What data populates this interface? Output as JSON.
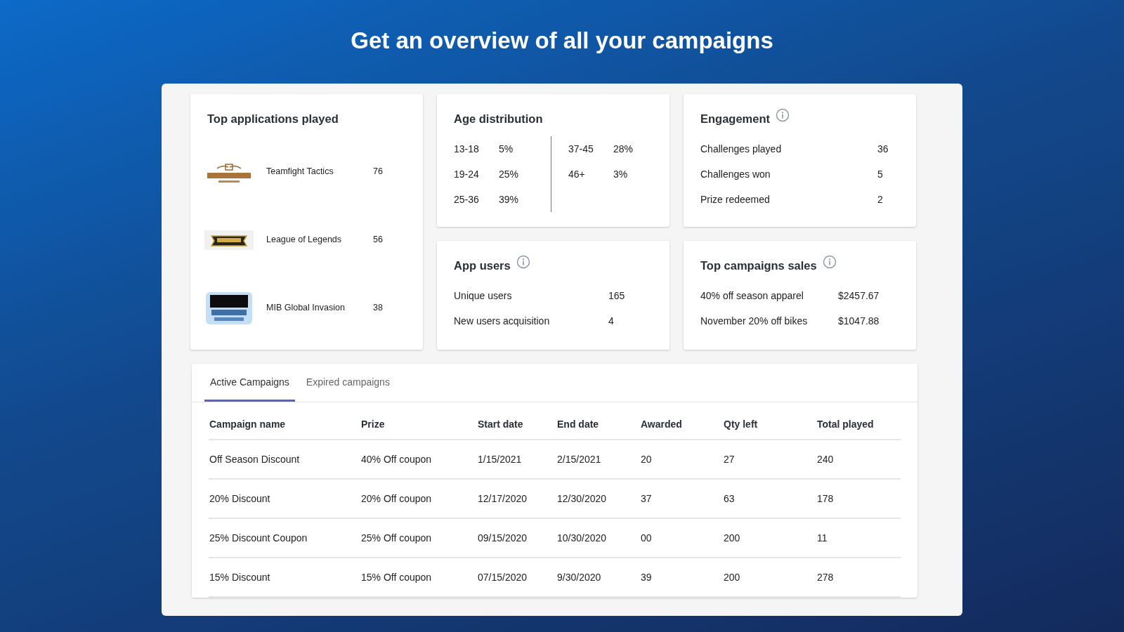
{
  "headline": "Get an overview of all your campaigns",
  "top_applications": {
    "title": "Top applications played",
    "items": [
      {
        "kind": "crest",
        "name": "Teamfight Tactics",
        "count": "76"
      },
      {
        "kind": "banner",
        "name": "League of Legends",
        "count": "56"
      },
      {
        "kind": "block",
        "name": "MIB Global Invasion",
        "count": "38"
      }
    ]
  },
  "age_distribution": {
    "title": "Age distribution",
    "groups": [
      [
        {
          "range": "13-18",
          "share": "5%"
        },
        {
          "range": "19-24",
          "share": "25%"
        },
        {
          "range": "25-36",
          "share": "39%"
        }
      ],
      [
        {
          "range": "37-45",
          "share": "28%"
        },
        {
          "range": "46+",
          "share": "3%"
        }
      ]
    ]
  },
  "engagement": {
    "title": "Engagement",
    "info": true,
    "rows": [
      {
        "label": "Challenges played",
        "value": "36"
      },
      {
        "label": "Challenges won",
        "value": "5"
      },
      {
        "label": "Prize redeemed",
        "value": "2"
      }
    ]
  },
  "app_users": {
    "title": "App users",
    "info": true,
    "rows": [
      {
        "label": "Unique users",
        "value": "165"
      },
      {
        "label": "New users acquisition",
        "value": "4"
      }
    ]
  },
  "top_campaign_sales": {
    "title": "Top campaigns sales",
    "info": true,
    "rows": [
      {
        "label": "40% off season apparel",
        "value": "$2457.67"
      },
      {
        "label": "November 20% off bikes",
        "value": "$1047.88"
      }
    ]
  },
  "tabs": [
    {
      "label": "Active Campaigns",
      "selected": true
    },
    {
      "label": "Expired campaigns",
      "selected": false
    }
  ],
  "table": {
    "columns": [
      "Campaign name",
      "Prize",
      "Start date",
      "End date",
      "Awarded",
      "Qty left",
      "Total played"
    ],
    "rows": [
      [
        "Off Season Discount",
        "40% Off coupon",
        "1/15/2021",
        "2/15/2021",
        "20",
        "27",
        "240"
      ],
      [
        "20% Discount",
        "20% Off coupon",
        "12/17/2020",
        "12/30/2020",
        "37",
        "63",
        "178"
      ],
      [
        "25% Discount Coupon",
        "25% Off coupon",
        "09/15/2020",
        "10/30/2020",
        "00",
        "200",
        "11"
      ],
      [
        "15% Discount",
        "15% Off coupon",
        "07/15/2020",
        "9/30/2020",
        "39",
        "200",
        "278"
      ]
    ]
  }
}
